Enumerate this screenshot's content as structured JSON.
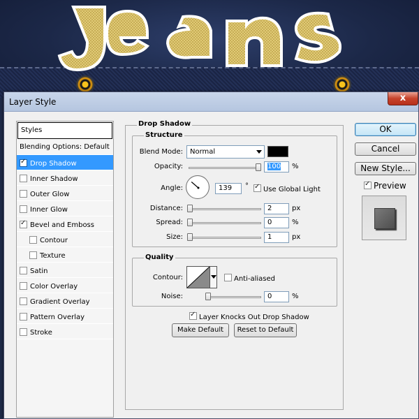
{
  "window": {
    "title": "Layer Style",
    "close_glyph": "x"
  },
  "background_art": {
    "logo_text": "Jeans"
  },
  "styles_panel": {
    "header": "Styles",
    "items": [
      {
        "label": "Blending Options: Default",
        "checkbox": false,
        "checked": false,
        "selected": false,
        "indent": false
      },
      {
        "label": "Drop Shadow",
        "checkbox": true,
        "checked": true,
        "selected": true,
        "indent": false
      },
      {
        "label": "Inner Shadow",
        "checkbox": true,
        "checked": false,
        "selected": false,
        "indent": false
      },
      {
        "label": "Outer Glow",
        "checkbox": true,
        "checked": false,
        "selected": false,
        "indent": false
      },
      {
        "label": "Inner Glow",
        "checkbox": true,
        "checked": false,
        "selected": false,
        "indent": false
      },
      {
        "label": "Bevel and Emboss",
        "checkbox": true,
        "checked": true,
        "selected": false,
        "indent": false
      },
      {
        "label": "Contour",
        "checkbox": true,
        "checked": false,
        "selected": false,
        "indent": true
      },
      {
        "label": "Texture",
        "checkbox": true,
        "checked": false,
        "selected": false,
        "indent": true
      },
      {
        "label": "Satin",
        "checkbox": true,
        "checked": false,
        "selected": false,
        "indent": false
      },
      {
        "label": "Color Overlay",
        "checkbox": true,
        "checked": false,
        "selected": false,
        "indent": false
      },
      {
        "label": "Gradient Overlay",
        "checkbox": true,
        "checked": false,
        "selected": false,
        "indent": false
      },
      {
        "label": "Pattern Overlay",
        "checkbox": true,
        "checked": false,
        "selected": false,
        "indent": false
      },
      {
        "label": "Stroke",
        "checkbox": true,
        "checked": false,
        "selected": false,
        "indent": false
      }
    ]
  },
  "drop_shadow": {
    "section_title": "Drop Shadow",
    "structure": {
      "title": "Structure",
      "blend_mode_label": "Blend Mode:",
      "blend_mode_value": "Normal",
      "shadow_color": "#000000",
      "opacity_label": "Opacity:",
      "opacity_value": "100",
      "opacity_unit": "%",
      "opacity_level": 1.0,
      "angle_label": "Angle:",
      "angle_value": "139",
      "angle_unit": "°",
      "angle_degrees": 139,
      "use_global_light_label": "Use Global Light",
      "use_global_light_checked": true,
      "distance_label": "Distance:",
      "distance_value": "2",
      "distance_unit": "px",
      "spread_label": "Spread:",
      "spread_value": "0",
      "spread_unit": "%",
      "size_label": "Size:",
      "size_value": "1",
      "size_unit": "px"
    },
    "quality": {
      "title": "Quality",
      "contour_label": "Contour:",
      "anti_aliased_label": "Anti-aliased",
      "anti_aliased_checked": false,
      "noise_label": "Noise:",
      "noise_value": "0",
      "noise_unit": "%"
    },
    "knockout_label": "Layer Knocks Out Drop Shadow",
    "knockout_checked": true,
    "make_default_label": "Make Default",
    "reset_default_label": "Reset to Default"
  },
  "actions": {
    "ok_label": "OK",
    "cancel_label": "Cancel",
    "new_style_label": "New Style...",
    "preview_label": "Preview",
    "preview_checked": true
  }
}
